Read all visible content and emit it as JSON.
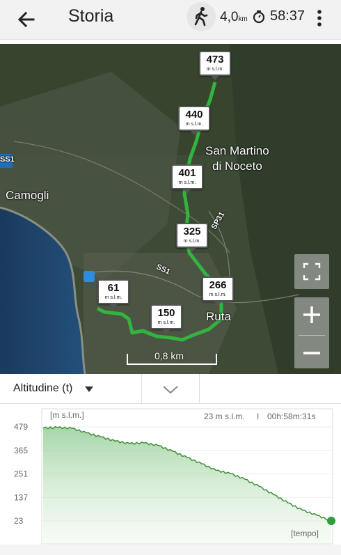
{
  "header": {
    "title": "Storia",
    "distance_value": "4,0",
    "distance_unit": "km",
    "duration": "58:37"
  },
  "map": {
    "labels": {
      "town1": "Camogli",
      "town2_line1": "San Martino",
      "town2_line2": "di Noceto",
      "town3": "Ruta",
      "road1": "SS1",
      "road2": "SP31",
      "road_shield": "SS1"
    },
    "scale_label": "0,8 km",
    "markers": [
      {
        "value": "473",
        "unit": "m s.l.m."
      },
      {
        "value": "440",
        "unit": "m s.l.m."
      },
      {
        "value": "401",
        "unit": "m s.l.m."
      },
      {
        "value": "325",
        "unit": "m s.l.m."
      },
      {
        "value": "266",
        "unit": "m s.l.m."
      },
      {
        "value": "150",
        "unit": "m s.l.m."
      },
      {
        "value": "61",
        "unit": "m s.l.m."
      }
    ]
  },
  "panel": {
    "dropdown_label": "Altitudine (t)"
  },
  "chart_data": {
    "type": "area",
    "title": "",
    "ylabel": "[m s.l.m.]",
    "xlabel": "[tempo]",
    "yticks": [
      "479",
      "365",
      "251",
      "137",
      "23"
    ],
    "ylim": [
      23,
      479
    ],
    "current_value": "23 m s.l.m.",
    "separator": "I",
    "current_time": "00h:58m:31s",
    "color": "#2e9e3e",
    "x": [
      0,
      0.05,
      0.1,
      0.15,
      0.2,
      0.25,
      0.3,
      0.35,
      0.4,
      0.45,
      0.5,
      0.55,
      0.6,
      0.65,
      0.7,
      0.75,
      0.8,
      0.85,
      0.9,
      0.95,
      1.0
    ],
    "values": [
      473,
      476,
      472,
      450,
      430,
      410,
      398,
      401,
      388,
      360,
      330,
      300,
      268,
      252,
      225,
      190,
      150,
      110,
      75,
      50,
      23
    ]
  }
}
